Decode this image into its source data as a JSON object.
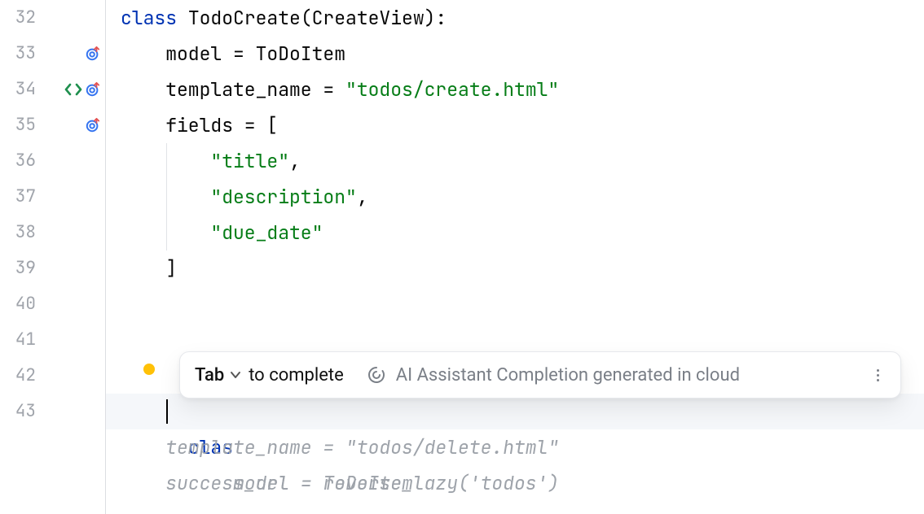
{
  "lines": {
    "32": "32",
    "33": "33",
    "34": "34",
    "35": "35",
    "36": "36",
    "37": "37",
    "38": "38",
    "39": "39",
    "40": "40",
    "41": "41",
    "42": "42",
    "43": "43"
  },
  "code": {
    "l32": {
      "t1": "class ",
      "t2": "TodoCreate(CreateView):"
    },
    "l33": {
      "t1": "    model = ToDoItem"
    },
    "l34": {
      "t1": "    template_name = ",
      "t2": "\"todos/create.html\""
    },
    "l35": {
      "t1": "    fields = ["
    },
    "l36": {
      "t1": "        ",
      "t2": "\"title\"",
      "t3": ","
    },
    "l37": {
      "t1": "        ",
      "t2": "\"description\"",
      "t3": ","
    },
    "l38": {
      "t1": "        ",
      "t2": "\"due_date\""
    },
    "l39": {
      "t1": "    ]"
    },
    "l40": {
      "t1": ""
    },
    "l41": {
      "t1": ""
    },
    "l42": {
      "t1": "clas"
    },
    "l43": {
      "t1": "    model = ToDoItem"
    },
    "l44": {
      "t1": "    template_name = \"todos/delete.html\""
    },
    "l45": {
      "t1": "    success_url = reverse_lazy('todos')"
    }
  },
  "hint": {
    "tab": "Tab",
    "complete": "to complete",
    "ai": "AI Assistant Completion generated in cloud"
  }
}
